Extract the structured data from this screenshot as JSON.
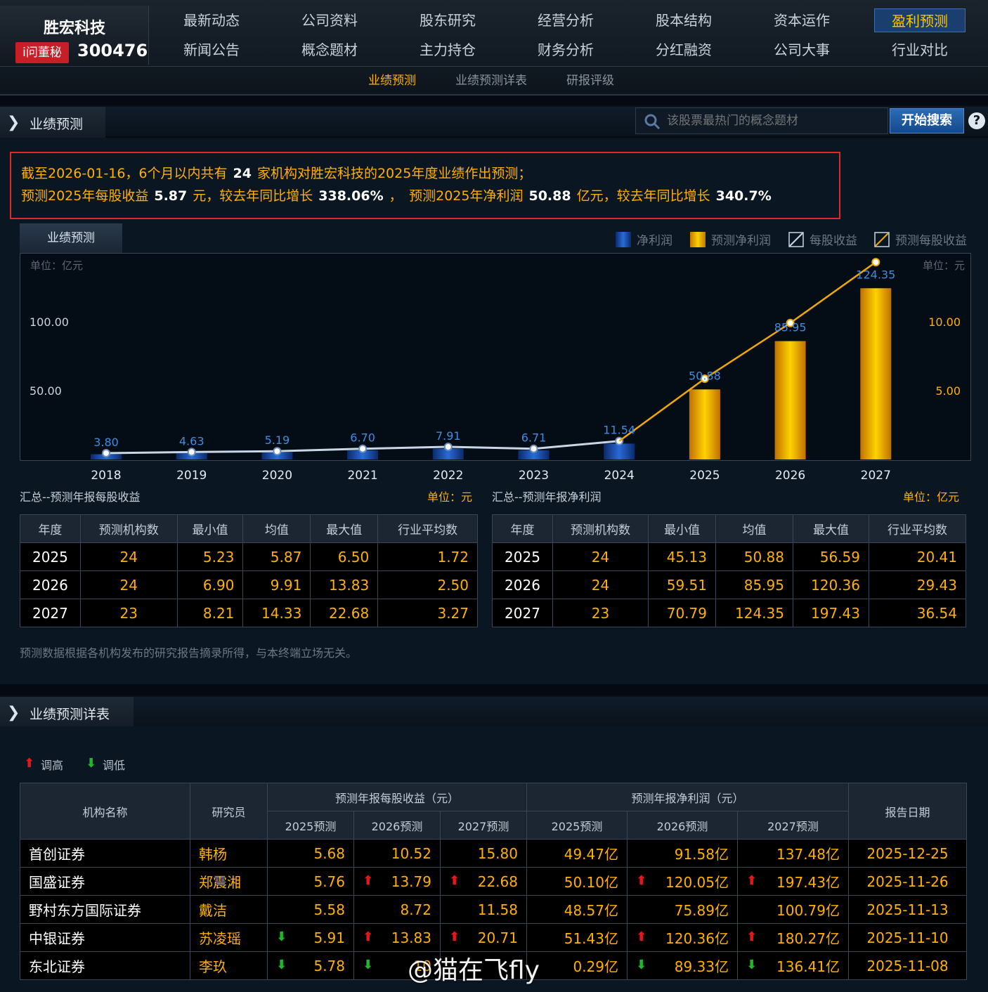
{
  "header": {
    "stock_name": "胜宏科技",
    "badge": "i问董秘",
    "stock_code": "300476"
  },
  "nav": {
    "row1": [
      "最新动态",
      "公司资料",
      "股东研究",
      "经营分析",
      "股本结构",
      "资本运作",
      "盈利预测"
    ],
    "row2": [
      "新闻公告",
      "概念题材",
      "主力持仓",
      "财务分析",
      "分红融资",
      "公司大事",
      "行业对比"
    ],
    "active": "盈利预测"
  },
  "subnav": [
    "业绩预测",
    "业绩预测详表",
    "研报评级"
  ],
  "section1": {
    "title": "业绩预测"
  },
  "search": {
    "placeholder": "该股票最热门的概念题材",
    "button": "开始搜索",
    "help": "?"
  },
  "alert": {
    "l1_a": "截至2026-01-16，6个月以内共有",
    "l1_b": "24",
    "l1_c": "家机构对胜宏科技的2025年度业绩作出预测；",
    "l2_a": "预测2025年每股收益",
    "l2_b": "5.87",
    "l2_c": "元，较去年同比增长",
    "l2_d": "338.06%",
    "l2_e": "，　预测2025年净利润",
    "l2_f": "50.88",
    "l2_g": "亿元，较去年同比增长",
    "l2_h": "340.7%"
  },
  "chart_tab": "业绩预测",
  "legend": [
    "净利润",
    "预测净利润",
    "每股收益",
    "预测每股收益"
  ],
  "colors": {
    "accent": "#ffb000",
    "net_profit": "#1a4fb0",
    "forecast": "#f0a800",
    "eps_line": "#c9d6e6",
    "forecast_line": "#f0a800",
    "alert_border": "#e1282a"
  },
  "chart_data": {
    "type": "bar",
    "categories": [
      "2018",
      "2019",
      "2020",
      "2021",
      "2022",
      "2023",
      "2024",
      "2025",
      "2026",
      "2027"
    ],
    "series": [
      {
        "name": "净利润",
        "values": [
          3.8,
          4.63,
          5.19,
          6.7,
          7.91,
          6.71,
          11.54,
          null,
          null,
          null
        ]
      },
      {
        "name": "预测净利润",
        "values": [
          null,
          null,
          null,
          null,
          null,
          null,
          null,
          50.88,
          85.95,
          124.35
        ]
      },
      {
        "name": "每股收益",
        "values": [
          0.46,
          0.54,
          0.6,
          0.78,
          0.92,
          0.78,
          1.34,
          null,
          null,
          null
        ]
      },
      {
        "name": "预测每股收益",
        "values": [
          null,
          null,
          null,
          null,
          null,
          null,
          1.34,
          5.87,
          9.91,
          14.33
        ]
      }
    ],
    "y_left": {
      "unit": "单位：亿元",
      "ticks": [
        "50.00",
        "100.00"
      ],
      "ylim": [
        0,
        150
      ]
    },
    "y_right": {
      "unit": "单位：元",
      "ticks": [
        "5.00",
        "10.00"
      ],
      "ylim": [
        0,
        15
      ]
    },
    "labels": [
      "3.80",
      "4.63",
      "5.19",
      "6.70",
      "7.91",
      "6.71",
      "11.54",
      "50.88",
      "85.95",
      "124.35"
    ]
  },
  "eps_summary": {
    "title": "汇总--预测年报每股收益",
    "unit": "单位：元",
    "headers": [
      "年度",
      "预测机构数",
      "最小值",
      "均值",
      "最大值",
      "行业平均数"
    ],
    "rows": [
      [
        "2025",
        "24",
        "5.23",
        "5.87",
        "6.50",
        "1.72"
      ],
      [
        "2026",
        "24",
        "6.90",
        "9.91",
        "13.83",
        "2.50"
      ],
      [
        "2027",
        "23",
        "8.21",
        "14.33",
        "22.68",
        "3.27"
      ]
    ]
  },
  "profit_summary": {
    "title": "汇总--预测年报净利润",
    "unit": "单位：亿元",
    "headers": [
      "年度",
      "预测机构数",
      "最小值",
      "均值",
      "最大值",
      "行业平均数"
    ],
    "rows": [
      [
        "2025",
        "24",
        "45.13",
        "50.88",
        "56.59",
        "20.41"
      ],
      [
        "2026",
        "24",
        "59.51",
        "85.95",
        "120.36",
        "29.43"
      ],
      [
        "2027",
        "23",
        "70.79",
        "124.35",
        "197.43",
        "36.54"
      ]
    ]
  },
  "disclaimer": "预测数据根据各机构发布的研究报告摘录所得，与本终端立场无关。",
  "section2": {
    "title": "业绩预测详表"
  },
  "arrow_legend": {
    "up": "调高",
    "down": "调低"
  },
  "detail": {
    "h_org": "机构名称",
    "h_analyst": "研究员",
    "h_eps": "预测年报每股收益（元）",
    "h_profit": "预测年报净利润（元）",
    "h_date": "报告日期",
    "sub": [
      "2025预测",
      "2026预测",
      "2027预测",
      "2025预测",
      "2026预测",
      "2027预测"
    ],
    "rows": [
      {
        "org": "首创证券",
        "analyst": "韩杨",
        "v": [
          "5.68",
          "10.52",
          "15.80",
          "49.47亿",
          "91.58亿",
          "137.48亿"
        ],
        "a": [
          "",
          "",
          "",
          "",
          "",
          ""
        ],
        "date": "2025-12-25"
      },
      {
        "org": "国盛证券",
        "analyst": "郑震湘",
        "v": [
          "5.76",
          "13.79",
          "22.68",
          "50.10亿",
          "120.05亿",
          "197.43亿"
        ],
        "a": [
          "",
          "up",
          "up",
          "",
          "up",
          "up"
        ],
        "date": "2025-11-26"
      },
      {
        "org": "野村东方国际证券",
        "analyst": "戴洁",
        "v": [
          "5.58",
          "8.72",
          "11.58",
          "48.57亿",
          "75.89亿",
          "100.79亿"
        ],
        "a": [
          "",
          "",
          "",
          "",
          "",
          ""
        ],
        "date": "2025-11-13"
      },
      {
        "org": "中银证券",
        "analyst": "苏凌瑶",
        "v": [
          "5.91",
          "13.83",
          "20.71",
          "51.43亿",
          "120.36亿",
          "180.27亿"
        ],
        "a": [
          "down",
          "up",
          "up",
          "",
          "up",
          "up"
        ],
        "date": "2025-11-10"
      },
      {
        "org": "东北证券",
        "analyst": "李玖",
        "v": [
          "5.78",
          "10",
          "",
          "0.29亿",
          "89.33亿",
          "136.41亿"
        ],
        "a": [
          "down",
          "down",
          "",
          "",
          "down",
          "down"
        ],
        "date": "2025-11-08"
      }
    ]
  },
  "watermark": "@猫在飞fly"
}
